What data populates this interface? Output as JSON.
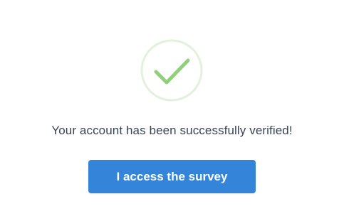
{
  "status": {
    "icon": "check-circle-icon",
    "circle_color": "#e3f1dc",
    "check_color": "#8fd07a"
  },
  "message": "Your account has been successfully verified!",
  "cta": {
    "label": "I access the survey",
    "color": "#3485d9"
  }
}
